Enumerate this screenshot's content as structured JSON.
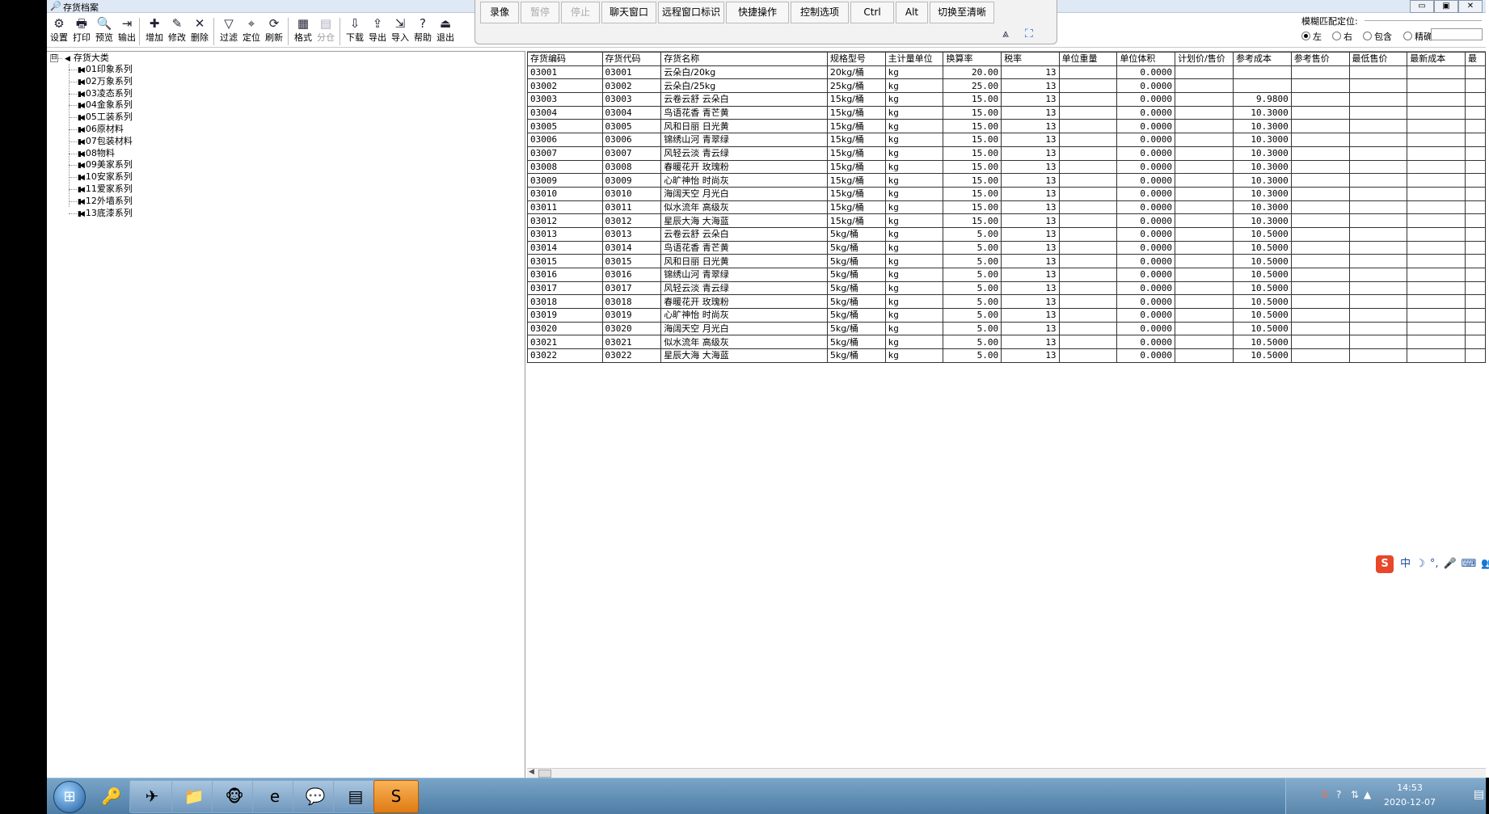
{
  "window": {
    "title": "存货档案",
    "controls": [
      "▭",
      "▣",
      "✕"
    ]
  },
  "toolbar": {
    "buttons": [
      {
        "label": "设置",
        "icon": "settings-icon",
        "glyph": "⚙",
        "enabled": true
      },
      {
        "label": "打印",
        "icon": "print-icon",
        "glyph": "🖶",
        "enabled": true
      },
      {
        "label": "预览",
        "icon": "preview-icon",
        "glyph": "🔍",
        "enabled": true
      },
      {
        "label": "输出",
        "icon": "output-icon",
        "glyph": "⇥",
        "enabled": true
      },
      {
        "label": "增加",
        "icon": "add-icon",
        "glyph": "✚",
        "enabled": true
      },
      {
        "label": "修改",
        "icon": "edit-icon",
        "glyph": "✎",
        "enabled": true
      },
      {
        "label": "删除",
        "icon": "delete-icon",
        "glyph": "✕",
        "enabled": true
      },
      {
        "label": "过滤",
        "icon": "filter-icon",
        "glyph": "▽",
        "enabled": true
      },
      {
        "label": "定位",
        "icon": "locate-icon",
        "glyph": "⌖",
        "enabled": true
      },
      {
        "label": "刷新",
        "icon": "refresh-icon",
        "glyph": "⟳",
        "enabled": true
      },
      {
        "label": "格式",
        "icon": "format-icon",
        "glyph": "▦",
        "enabled": true
      },
      {
        "label": "分仓",
        "icon": "split-warehouse-icon",
        "glyph": "▤",
        "enabled": false
      },
      {
        "label": "下载",
        "icon": "download-icon",
        "glyph": "⇩",
        "enabled": true
      },
      {
        "label": "导出",
        "icon": "export-icon",
        "glyph": "⇪",
        "enabled": true
      },
      {
        "label": "导入",
        "icon": "import-icon",
        "glyph": "⇲",
        "enabled": true
      },
      {
        "label": "帮助",
        "icon": "help-icon",
        "glyph": "?",
        "enabled": true
      },
      {
        "label": "退出",
        "icon": "exit-icon",
        "glyph": "⏏",
        "enabled": true
      }
    ]
  },
  "remote_bar": {
    "buttons": [
      {
        "label": "录像",
        "enabled": true
      },
      {
        "label": "暂停",
        "enabled": false
      },
      {
        "label": "停止",
        "enabled": false
      },
      {
        "label": "聊天窗口",
        "enabled": true
      },
      {
        "label": "远程窗口标识",
        "enabled": true
      },
      {
        "label": "快捷操作",
        "enabled": true
      },
      {
        "label": "控制选项",
        "enabled": true
      },
      {
        "label": "Ctrl",
        "enabled": true
      },
      {
        "label": "Alt",
        "enabled": true
      },
      {
        "label": "切换至清晰",
        "enabled": true
      }
    ]
  },
  "fuzzy_match": {
    "legend": "模糊匹配定位:",
    "options": [
      {
        "label": "左",
        "checked": true
      },
      {
        "label": "右",
        "checked": false
      },
      {
        "label": "包含",
        "checked": false
      },
      {
        "label": "精确",
        "checked": false
      }
    ],
    "input_value": ""
  },
  "tree": {
    "expander": "⊟",
    "root": "存货大类",
    "children": [
      "01印象系列",
      "02万象系列",
      "03凌态系列",
      "04金象系列",
      "05工装系列",
      "06原材料",
      "07包装材料",
      "08物料",
      "09美家系列",
      "10安家系列",
      "11爱家系列",
      "12外墙系列",
      "13底漆系列"
    ]
  },
  "grid": {
    "columns": [
      "存货编码",
      "存货代码",
      "存货名称",
      "规格型号",
      "主计量单位",
      "换算率",
      "税率",
      "单位重量",
      "单位体积",
      "计划价/售价",
      "参考成本",
      "参考售价",
      "最低售价",
      "最新成本",
      "最"
    ],
    "rows": [
      [
        "03001",
        "03001",
        "云朵白/20kg",
        "20kg/桶",
        "kg",
        "20.00",
        "13",
        "",
        "0.0000",
        "",
        "",
        "",
        "",
        "",
        ""
      ],
      [
        "03002",
        "03002",
        "云朵白/25kg",
        "25kg/桶",
        "kg",
        "25.00",
        "13",
        "",
        "0.0000",
        "",
        "",
        "",
        "",
        "",
        ""
      ],
      [
        "03003",
        "03003",
        "云卷云舒 云朵白",
        "15kg/桶",
        "kg",
        "15.00",
        "13",
        "",
        "0.0000",
        "",
        "9.9800",
        "",
        "",
        "",
        ""
      ],
      [
        "03004",
        "03004",
        "鸟语花香 青芒黄",
        "15kg/桶",
        "kg",
        "15.00",
        "13",
        "",
        "0.0000",
        "",
        "10.3000",
        "",
        "",
        "",
        ""
      ],
      [
        "03005",
        "03005",
        "风和日丽 日光黄",
        "15kg/桶",
        "kg",
        "15.00",
        "13",
        "",
        "0.0000",
        "",
        "10.3000",
        "",
        "",
        "",
        ""
      ],
      [
        "03006",
        "03006",
        "锦绣山河 青翠绿",
        "15kg/桶",
        "kg",
        "15.00",
        "13",
        "",
        "0.0000",
        "",
        "10.3000",
        "",
        "",
        "",
        ""
      ],
      [
        "03007",
        "03007",
        "风轻云淡 青云绿",
        "15kg/桶",
        "kg",
        "15.00",
        "13",
        "",
        "0.0000",
        "",
        "10.3000",
        "",
        "",
        "",
        ""
      ],
      [
        "03008",
        "03008",
        "春暖花开 玫瑰粉",
        "15kg/桶",
        "kg",
        "15.00",
        "13",
        "",
        "0.0000",
        "",
        "10.3000",
        "",
        "",
        "",
        ""
      ],
      [
        "03009",
        "03009",
        "心旷神怡 时尚灰",
        "15kg/桶",
        "kg",
        "15.00",
        "13",
        "",
        "0.0000",
        "",
        "10.3000",
        "",
        "",
        "",
        ""
      ],
      [
        "03010",
        "03010",
        "海阔天空 月光白",
        "15kg/桶",
        "kg",
        "15.00",
        "13",
        "",
        "0.0000",
        "",
        "10.3000",
        "",
        "",
        "",
        ""
      ],
      [
        "03011",
        "03011",
        "似水流年 高级灰",
        "15kg/桶",
        "kg",
        "15.00",
        "13",
        "",
        "0.0000",
        "",
        "10.3000",
        "",
        "",
        "",
        ""
      ],
      [
        "03012",
        "03012",
        "星辰大海 大海蓝",
        "15kg/桶",
        "kg",
        "15.00",
        "13",
        "",
        "0.0000",
        "",
        "10.3000",
        "",
        "",
        "",
        ""
      ],
      [
        "03013",
        "03013",
        "云卷云舒 云朵白",
        "5kg/桶",
        "kg",
        "5.00",
        "13",
        "",
        "0.0000",
        "",
        "10.5000",
        "",
        "",
        "",
        ""
      ],
      [
        "03014",
        "03014",
        "鸟语花香 青芒黄",
        "5kg/桶",
        "kg",
        "5.00",
        "13",
        "",
        "0.0000",
        "",
        "10.5000",
        "",
        "",
        "",
        ""
      ],
      [
        "03015",
        "03015",
        "风和日丽 日光黄",
        "5kg/桶",
        "kg",
        "5.00",
        "13",
        "",
        "0.0000",
        "",
        "10.5000",
        "",
        "",
        "",
        ""
      ],
      [
        "03016",
        "03016",
        "锦绣山河 青翠绿",
        "5kg/桶",
        "kg",
        "5.00",
        "13",
        "",
        "0.0000",
        "",
        "10.5000",
        "",
        "",
        "",
        ""
      ],
      [
        "03017",
        "03017",
        "风轻云淡 青云绿",
        "5kg/桶",
        "kg",
        "5.00",
        "13",
        "",
        "0.0000",
        "",
        "10.5000",
        "",
        "",
        "",
        ""
      ],
      [
        "03018",
        "03018",
        "春暖花开 玫瑰粉",
        "5kg/桶",
        "kg",
        "5.00",
        "13",
        "",
        "0.0000",
        "",
        "10.5000",
        "",
        "",
        "",
        ""
      ],
      [
        "03019",
        "03019",
        "心旷神怡 时尚灰",
        "5kg/桶",
        "kg",
        "5.00",
        "13",
        "",
        "0.0000",
        "",
        "10.5000",
        "",
        "",
        "",
        ""
      ],
      [
        "03020",
        "03020",
        "海阔天空 月光白",
        "5kg/桶",
        "kg",
        "5.00",
        "13",
        "",
        "0.0000",
        "",
        "10.5000",
        "",
        "",
        "",
        ""
      ],
      [
        "03021",
        "03021",
        "似水流年 高级灰",
        "5kg/桶",
        "kg",
        "5.00",
        "13",
        "",
        "0.0000",
        "",
        "10.5000",
        "",
        "",
        "",
        ""
      ],
      [
        "03022",
        "03022",
        "星辰大海 大海蓝",
        "5kg/桶",
        "kg",
        "5.00",
        "13",
        "",
        "0.0000",
        "",
        "10.5000",
        "",
        "",
        "",
        ""
      ]
    ]
  },
  "ime": {
    "logo": "S",
    "items": [
      "中",
      "☽",
      "°,",
      "🎤",
      "⌨",
      "👥",
      "👕",
      "▦"
    ]
  },
  "taskbar": {
    "apps": [
      {
        "name": "key-tool-icon",
        "glyph": "🔑"
      },
      {
        "name": "dingtalk-icon",
        "glyph": "✈"
      },
      {
        "name": "file-explorer-icon",
        "glyph": "📁"
      },
      {
        "name": "monkey-app-icon",
        "glyph": "🐵"
      },
      {
        "name": "browser-icon",
        "glyph": "e"
      },
      {
        "name": "wechat-icon",
        "glyph": "💬"
      },
      {
        "name": "window-app-icon",
        "glyph": "▤"
      },
      {
        "name": "remote-app-icon",
        "glyph": "S"
      }
    ],
    "tray": {
      "time": "14:53",
      "date": "2020-12-07"
    }
  },
  "colors": {
    "taskbar": "#4d7ca4",
    "active_app": "#e07a12",
    "ime_brand": "#e8472a"
  }
}
